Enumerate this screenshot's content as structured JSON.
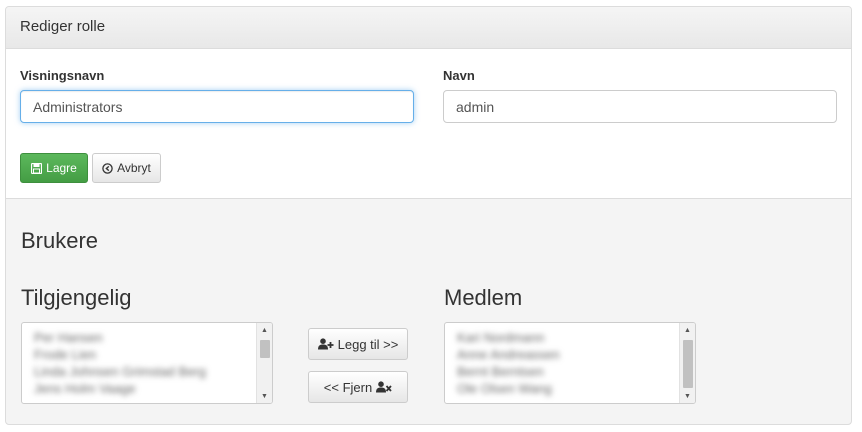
{
  "panel": {
    "title": "Rediger rolle"
  },
  "form": {
    "display_name": {
      "label": "Visningsnavn",
      "value": "Administrators"
    },
    "name": {
      "label": "Navn",
      "value": "admin"
    },
    "save_label": "Lagre",
    "cancel_label": "Avbryt"
  },
  "users": {
    "heading": "Brukere",
    "available": {
      "heading": "Tilgjengelig",
      "items": [
        "Per Hansen",
        "Frode Lien",
        "Linda Johnsen Grimstad Berg",
        "Jens Holm Vaage"
      ]
    },
    "members": {
      "heading": "Medlem",
      "items": [
        "Kari Nordmann",
        "Anne Andreassen",
        "Bernt Berntsen",
        "Ole Olsen Wang"
      ]
    },
    "add_label": "Legg til >>",
    "remove_label": "<< Fjern"
  },
  "icons": {
    "save": "floppy-disk-icon",
    "cancel": "circle-arrow-icon",
    "add": "user-plus-icon",
    "remove": "user-remove-icon"
  },
  "colors": {
    "success": "#5cb85c",
    "focus_border": "#66afe9",
    "panel_bg": "#f4f4f4"
  }
}
